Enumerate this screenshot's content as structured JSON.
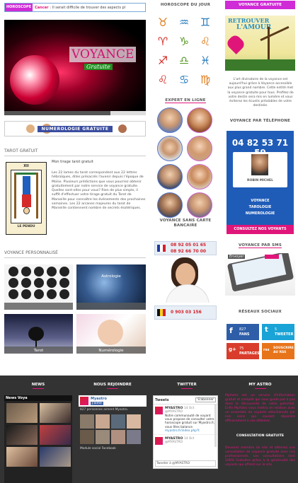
{
  "ticker": {
    "label": "HOROSCOPE",
    "sign": "Cancer",
    "text": ": Il serait difficile de trouver des aspects pl"
  },
  "hero": {
    "title": "VOYANCE",
    "subtitle": "Gratuite"
  },
  "numerology_banner": "NUMEROLOGIE GRATUITE",
  "tarot": {
    "heading": "TAROT GRATUIT",
    "link": "Mon tirage tarot gratuit",
    "body": "Les 22 lames du tarot correspondent aux 22 lettres hébraïques, dites présacrés l'avenir depuis l'époque de Moïse. Plusieurs prédictions que vous pourriez obtenir gratuitement par notre service de voyance gratuite. Quelles sont-elles pour vous? Rien de plus simple, il suffit d'effectuer votre tirage gratuit du Tarot de Marseille pour connaître les événements des prochaines semaines. Les 22 arcanes majeures du tarot de Marseille contiennent nombre de secrets ésotériques.",
    "card_number": "XII",
    "card_name": "LE PENDU"
  },
  "perso": {
    "heading": "VOYANCE PERSONNALISÉ",
    "tiles": [
      {
        "label": ""
      },
      {
        "label": "Astrologie"
      },
      {
        "label": "Tarot"
      },
      {
        "label": "Numérologie"
      }
    ]
  },
  "horoscope": {
    "heading": "HOROSCOPE DU JOUR",
    "signs": [
      "♉",
      "♒",
      "♊",
      "♈",
      "♑",
      "♌",
      "♐",
      "♎",
      "♓",
      "♌",
      "♋",
      "♍"
    ]
  },
  "experts": {
    "heading": "EXPERT EN LIGNE"
  },
  "no_card": {
    "heading": "VOYANCE SANS CARTE BANCAIRE",
    "phone_fr_1": "08 92 05 01 65",
    "phone_fr_2": "08 92 66 70 00",
    "phone_be": "0 903 03 156"
  },
  "right": {
    "free_heading": "VOYANCE GRATUITE",
    "promo_title_1": "RETROUVER",
    "promo_title_2": "L'AMOUR",
    "promo_text": "L'art divinatoire de la voyance est aujourd'hui grâce à Voyance accessible aux plus grand nombre. Cette entité met la voyance gratuite pour tous. Profitez de votre destin sera mis en lumière et vous éviterez les écueils préalables de votre destinée.",
    "phone_heading": "VOYANCE PAR TÉLÉPHONE",
    "phone_number": "04 82 53 71 59",
    "expert_name": "ROBIN MICHEL",
    "services": [
      "VOYANCE",
      "TAROLOGIE",
      "NUMEROLOGIE"
    ],
    "consult_btn": "CONSULTEZ NOS VOYANTS",
    "sms_heading": "VOYANCE PAR SMS",
    "sms_send": "Envoyer",
    "social_heading": "RÉSEAUX SOCIAUX",
    "social": [
      {
        "icon": "f",
        "count": "827",
        "unit": "FANS",
        "color": "#2e5ea8"
      },
      {
        "icon": "t",
        "count": "5",
        "unit": "TWEETER",
        "color": "#1aa3d6"
      },
      {
        "icon": "g+",
        "count": "75",
        "unit": "PARTAGES",
        "color": "#d93c2b"
      },
      {
        "icon": "rss",
        "count": "",
        "unit": "SOUSCRIRE AU RSS",
        "color": "#e8741a"
      }
    ]
  },
  "footer": {
    "news_heading": "NEWS",
    "news_tab": "News Voya",
    "join_heading": "NOUS REJOINDRE",
    "join_name": "Myastro",
    "join_like": "J'aime",
    "join_count": "827 personnes aiment Myastro.",
    "join_plugin": "Module social Facebook",
    "twitter_heading": "TWITTER",
    "tweets_label": "Tweets",
    "follow_label": "S'abonner",
    "tweet_user": "MYASTRO",
    "tweet_handle": "@MYASTRO",
    "tweet_date": "14 Oct",
    "tweet_text": "Notre communauté de voyant vous propose de consulter votre horoscope gratuit sur Myastro.fr, vous êtes balance",
    "tweet_link": "myastro.fr/index.php?t",
    "tweet_to": "Tweeter à @MYASTRO",
    "myastro_heading": "MY ASTRO",
    "myastro_text": "MyAstro est un service d'information gratuit et complet qui vous guide pas à pas dans la découverte de votre potentiel. Enfin MyAstro vous mettra en relation avec un ensemble de voyants sélectionnés par nos soins qui sauront répondre efficacement à vos attentes.",
    "consult_title": "CONSULTATION GRATUITE",
    "consult_text": "Devenez membre du site et obtenez une consultation de voyance gratuite avec nos professionnels. Les consultations sont 100% Gratuites grâce à la générosité des voyants qui offrent sur le site."
  }
}
